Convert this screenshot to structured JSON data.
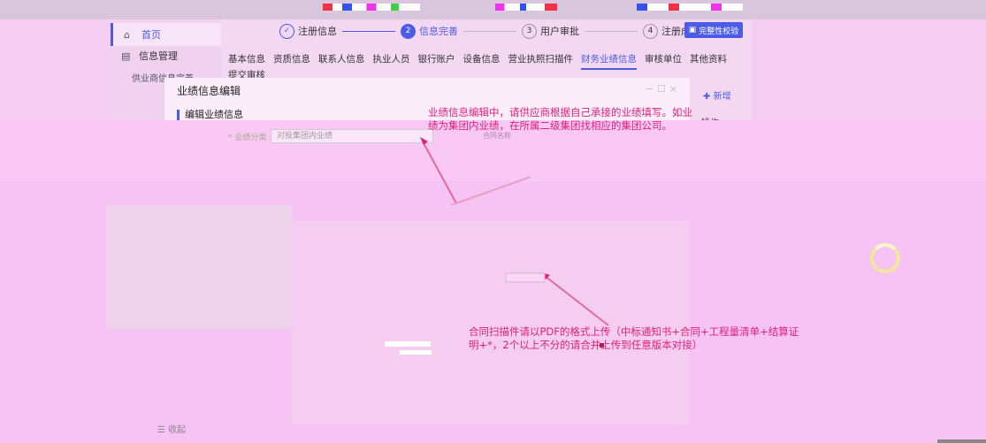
{
  "colors": {
    "accent": "#4b5de8",
    "annotation": "#e0207a"
  },
  "sidebar": {
    "items": [
      {
        "icon": "home-icon",
        "label": "首页"
      },
      {
        "icon": "list-icon",
        "label": "信息管理"
      },
      {
        "label": "供业商信息完善"
      }
    ],
    "collapse_label": "收起"
  },
  "steps": [
    {
      "num": "✓",
      "label": "注册信息",
      "state": "done"
    },
    {
      "num": "2",
      "label": "信息完善",
      "state": "current"
    },
    {
      "num": "3",
      "label": "用户审批",
      "state": "todo"
    },
    {
      "num": "4",
      "label": "注册成功",
      "state": "todo"
    }
  ],
  "check_button": "完整性校验",
  "tabs": [
    "基本信息",
    "资质信息",
    "联系人信息",
    "执业人员",
    "银行账户",
    "设备信息",
    "营业执照扫描件",
    "财务业绩信息",
    "审核单位",
    "其他资料"
  ],
  "active_tab": "财务业绩信息",
  "tab_extra": "提交审核",
  "add_button": "新增",
  "op_column": "操作",
  "modal": {
    "title": "业绩信息编辑",
    "section_title": "编辑业绩信息",
    "field_label": "* 业绩分类",
    "field_value": "对投集团内业绩",
    "field_label2": "合同名称"
  },
  "notes": {
    "note1": "业绩信息编辑中，请供应商根据自己承接的业绩填写。如业绩为集团内业绩，在所属二级集团找相应的集团公司。",
    "note2": "合同扫描件请以PDF的格式上传（中标通知书+合同+工程量清单+结算证明+*，2个以上不分的请合并上传到任意版本对接）"
  }
}
